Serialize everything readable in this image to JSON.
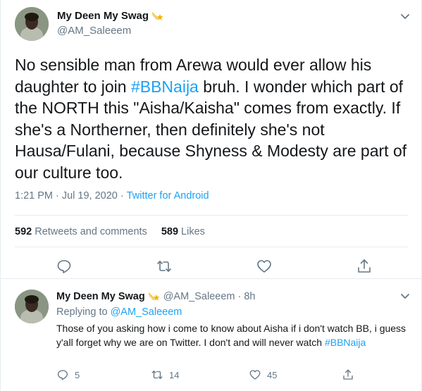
{
  "colors": {
    "accent": "#1da1f2",
    "muted": "#657786",
    "text": "#14171a",
    "border": "#e6ecf0"
  },
  "tweet": {
    "display_name": "My Deen My Swag",
    "name_emoji": "shooting-star-icon",
    "handle": "@AM_Saleeem",
    "text_before": "No sensible man from Arewa would ever allow his daughter to join ",
    "hashtag": "#BBNaija",
    "text_after": " bruh. I wonder which part of the NORTH this \"Aisha/Kaisha\" comes from exactly. If she's a Northerner, then definitely she's not Hausa/Fulani, because Shyness & Modesty are part of our culture too.",
    "time": "1:21 PM",
    "date": "Jul 19, 2020",
    "separator": "·",
    "source": "Twitter for Android",
    "retweets_count": "592",
    "retweets_label": "Retweets and comments",
    "likes_count": "589",
    "likes_label": "Likes",
    "actions": [
      "reply-icon",
      "retweet-icon",
      "like-icon",
      "share-icon"
    ]
  },
  "reply": {
    "display_name": "My Deen My Swag",
    "handle": "@AM_Saleeem",
    "separator": "·",
    "age": "8h",
    "replying_prefix": "Replying to ",
    "replying_handle": "@AM_Saleeem",
    "text": "Those of you asking how i come to know about Aisha if i don't watch BB, i guess y'all forget why we are on Twitter. I don't and will never watch ",
    "hashtag": "#BBNaija",
    "reply_count": "5",
    "retweet_count": "14",
    "like_count": "45"
  }
}
